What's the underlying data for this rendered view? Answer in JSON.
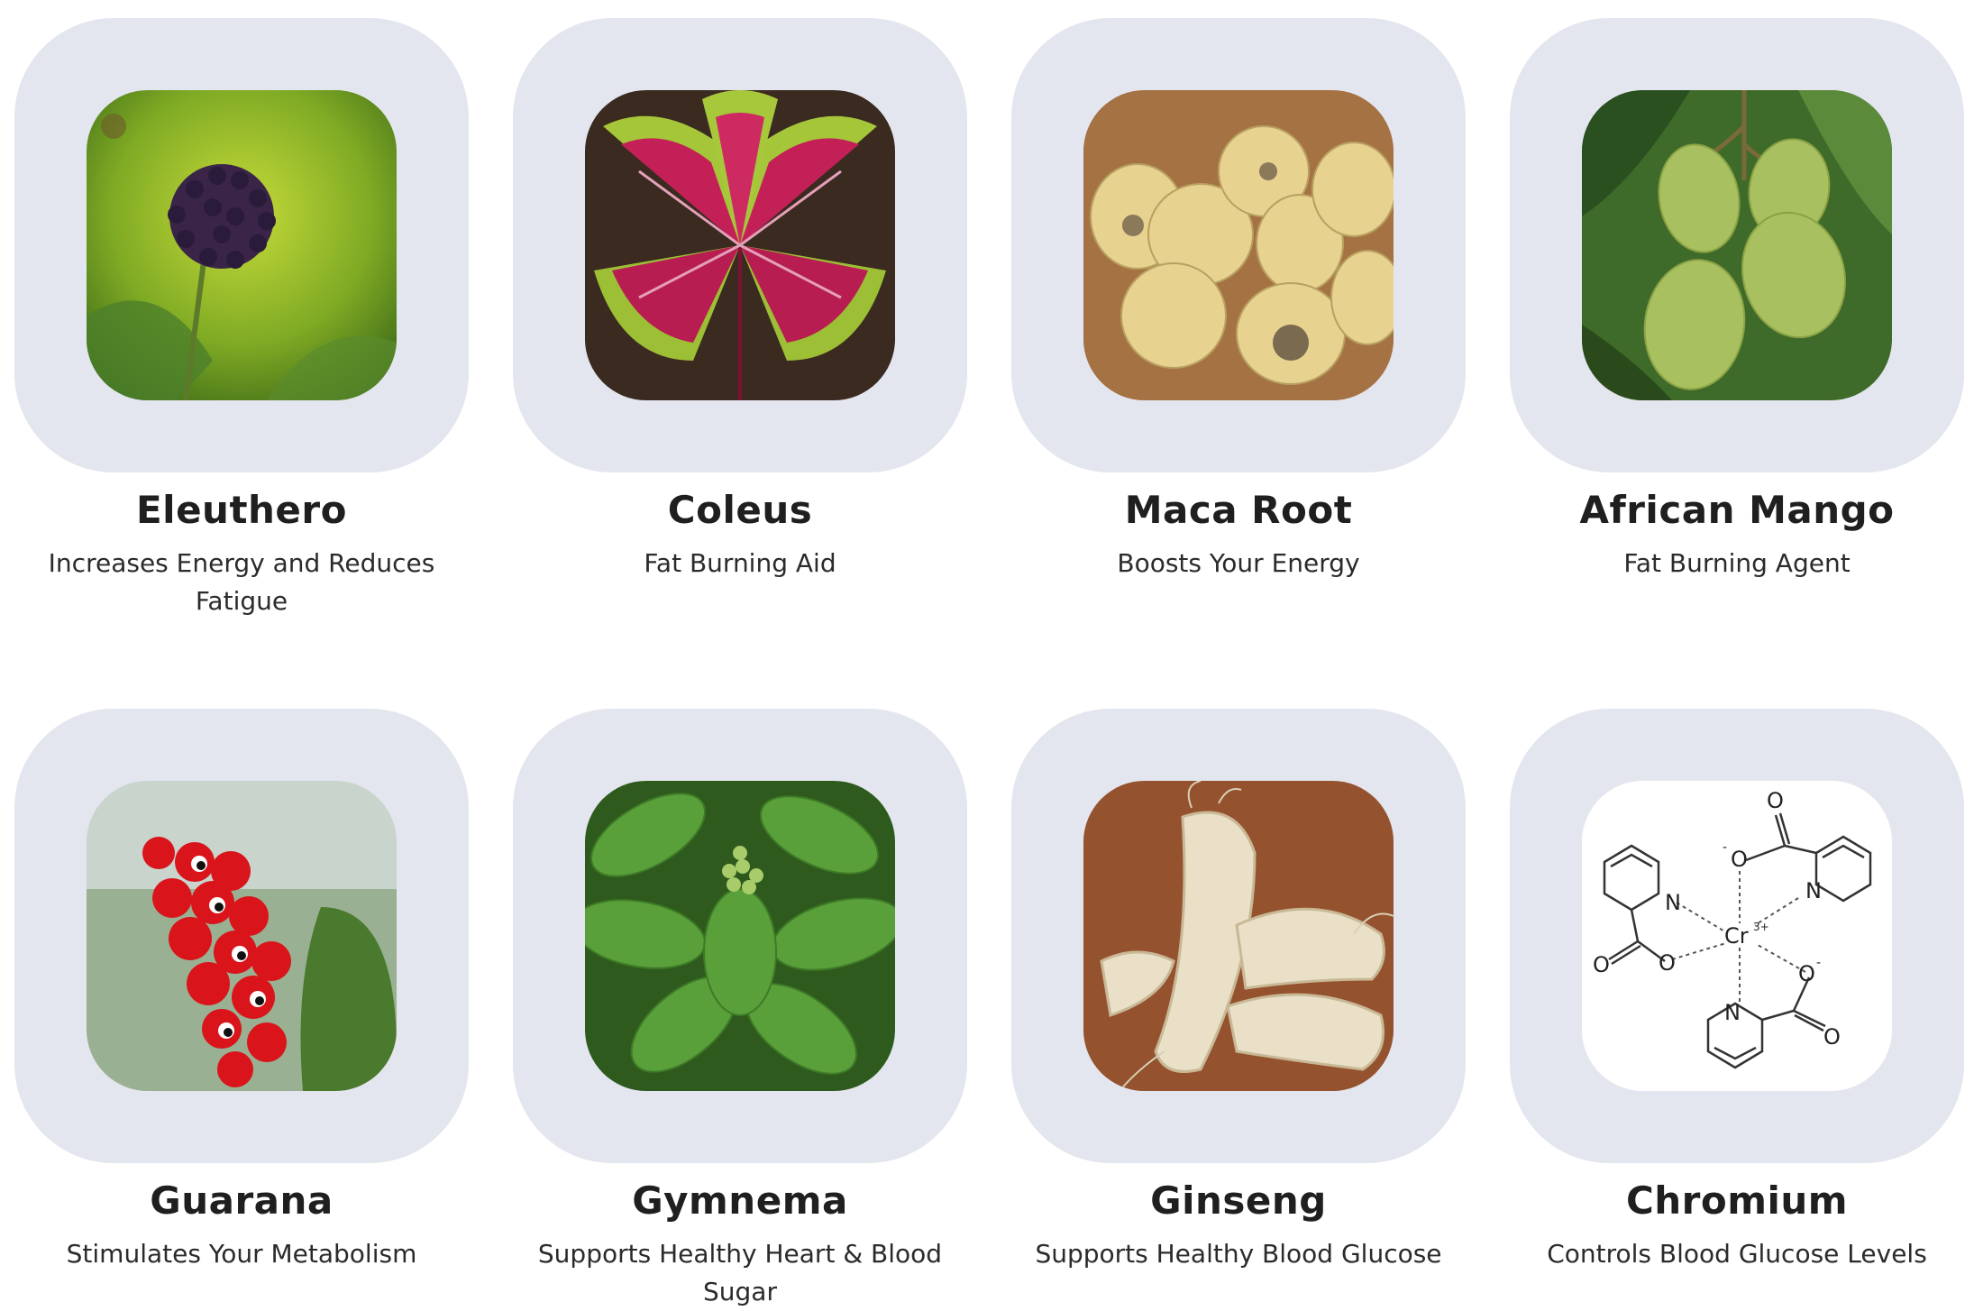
{
  "ingredients": [
    {
      "name": "Eleuthero",
      "benefit": "Increases Energy and Reduces Fatigue",
      "image_icon": "eleuthero-berry-cluster-photo"
    },
    {
      "name": "Coleus",
      "benefit": "Fat Burning Aid",
      "image_icon": "coleus-leaves-photo"
    },
    {
      "name": "Maca Root",
      "benefit": "Boosts Your Energy",
      "image_icon": "maca-roots-photo"
    },
    {
      "name": "African Mango",
      "benefit": "Fat Burning Agent",
      "image_icon": "african-mango-fruit-photo"
    },
    {
      "name": "Guarana",
      "benefit": "Stimulates Your Metabolism",
      "image_icon": "guarana-berries-photo"
    },
    {
      "name": "Gymnema",
      "benefit": "Supports Healthy Heart & Blood Sugar",
      "image_icon": "gymnema-leaves-photo"
    },
    {
      "name": "Ginseng",
      "benefit": "Supports Healthy Blood Glucose",
      "image_icon": "ginseng-roots-photo"
    },
    {
      "name": "Chromium",
      "benefit": "Controls Blood Glucose Levels",
      "image_icon": "chromium-picolinate-structure"
    }
  ],
  "chem": {
    "o": "O",
    "o_minus": "O",
    "minus": "-",
    "n": "N",
    "cr": "Cr",
    "cr_charge": "3+"
  },
  "colors": {
    "tile_bg": "#e4e6ef",
    "title": "#1f1f1f",
    "text": "#2b2b2b"
  }
}
